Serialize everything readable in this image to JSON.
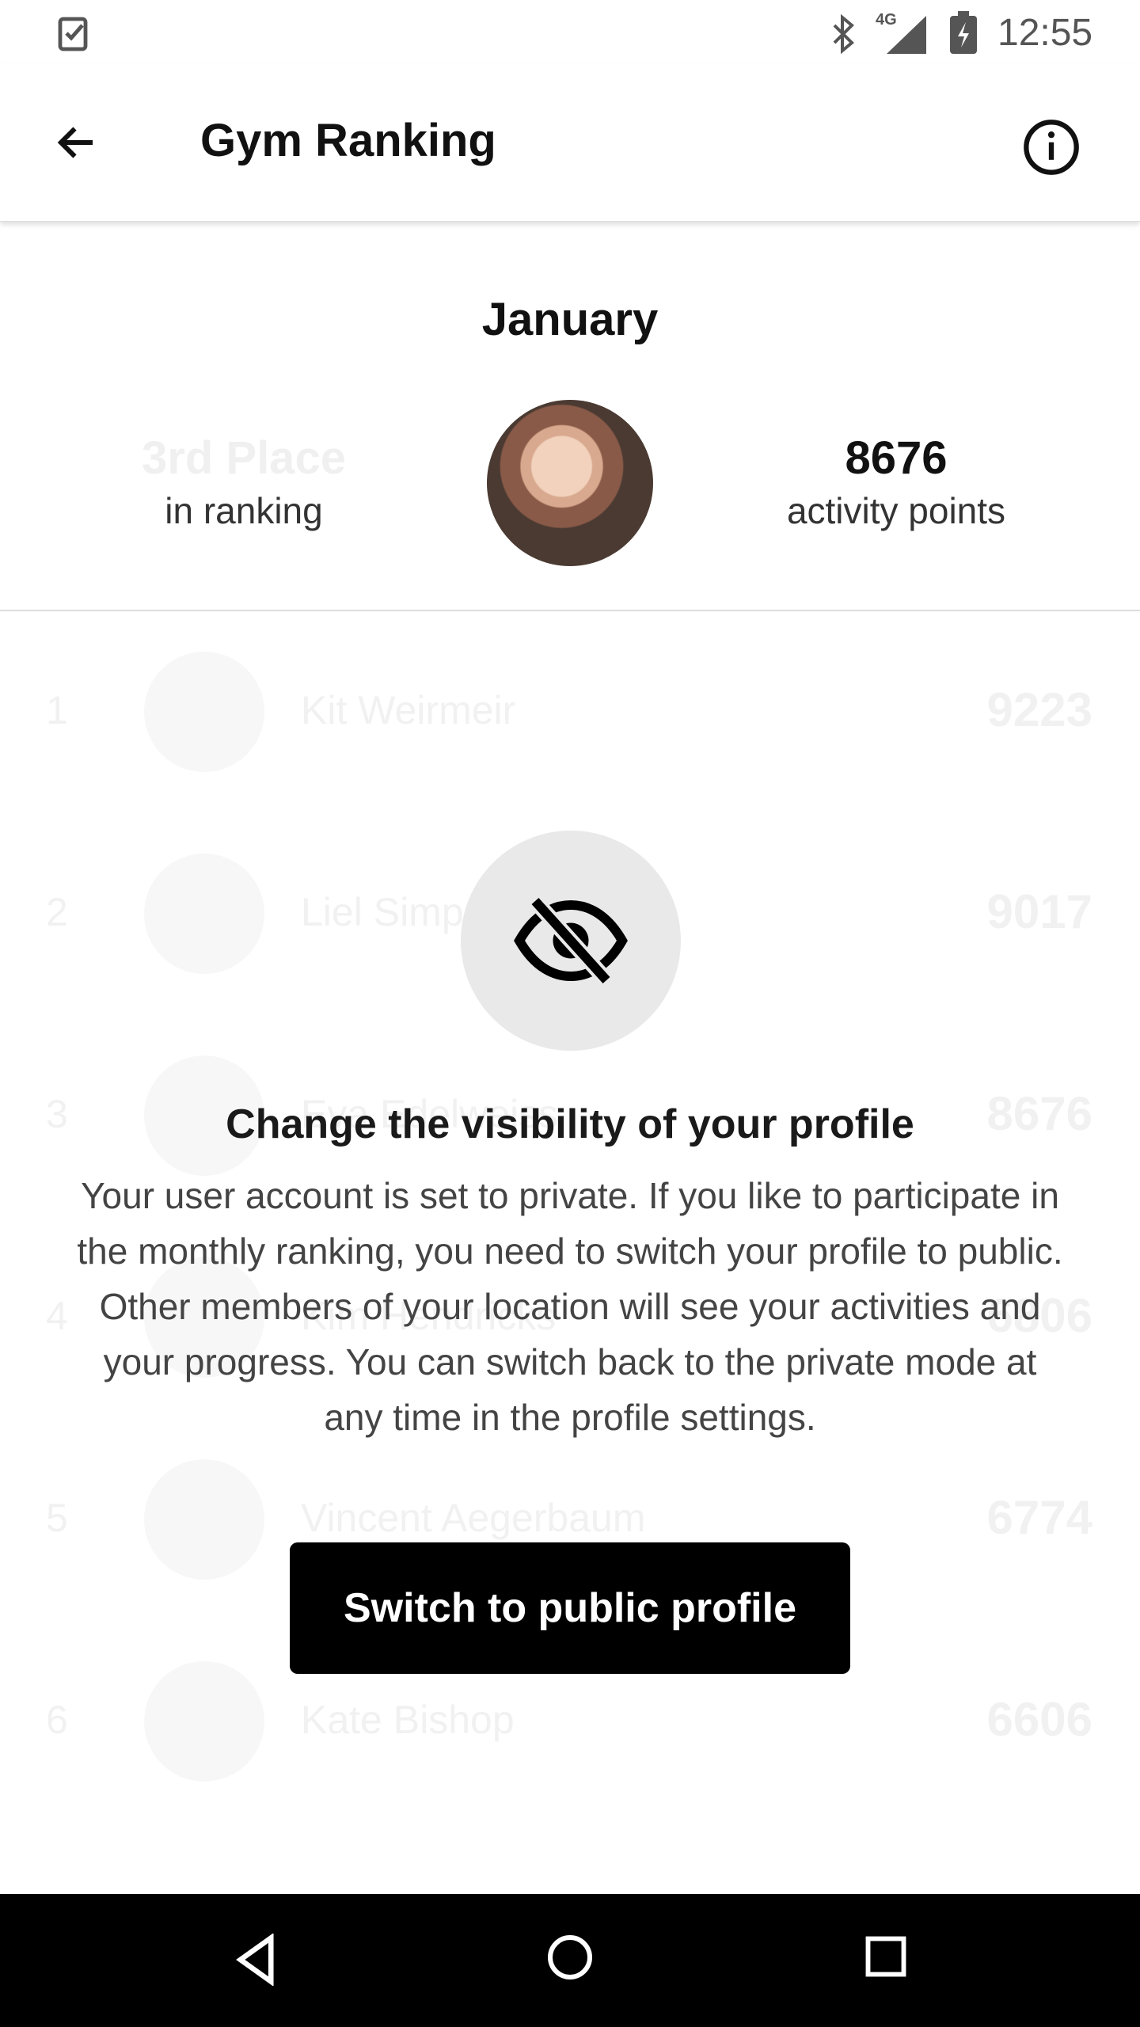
{
  "status_bar": {
    "time": "12:55",
    "network": "4G",
    "icons": [
      "task-check-icon",
      "bluetooth-icon",
      "signal-icon",
      "battery-charging-icon"
    ]
  },
  "app_bar": {
    "title": "Gym Ranking",
    "back_icon": "arrow-left-icon",
    "info_icon": "info-icon"
  },
  "summary": {
    "month": "January",
    "place": "3rd Place",
    "place_label": "in ranking",
    "points": "8676",
    "points_label": "activity points"
  },
  "ranking": [
    {
      "rank": "1",
      "name": "Kit Weirmeir",
      "points": "9223"
    },
    {
      "rank": "2",
      "name": "Liel Simp",
      "points": "9017"
    },
    {
      "rank": "3",
      "name": "Eva Edelweiss",
      "points": "8676"
    },
    {
      "rank": "4",
      "name": "Kim Hendricks",
      "points": "6806"
    },
    {
      "rank": "5",
      "name": "Vincent Aegerbaum",
      "points": "6774"
    },
    {
      "rank": "6",
      "name": "Kate Bishop",
      "points": "6606"
    }
  ],
  "overlay": {
    "icon": "eye-off-icon",
    "heading": "Change the visibility of your profile",
    "body": "Your user account is set to private. If you like to participate in the monthly ranking, you need to switch your profile to public. Other members of your location will see your activities and your progress. You can switch back to the private mode at any time in the profile settings.",
    "button": "Switch to public profile"
  },
  "nav_bar": {
    "icons": [
      "back-triangle-icon",
      "home-circle-icon",
      "recents-square-icon"
    ]
  }
}
